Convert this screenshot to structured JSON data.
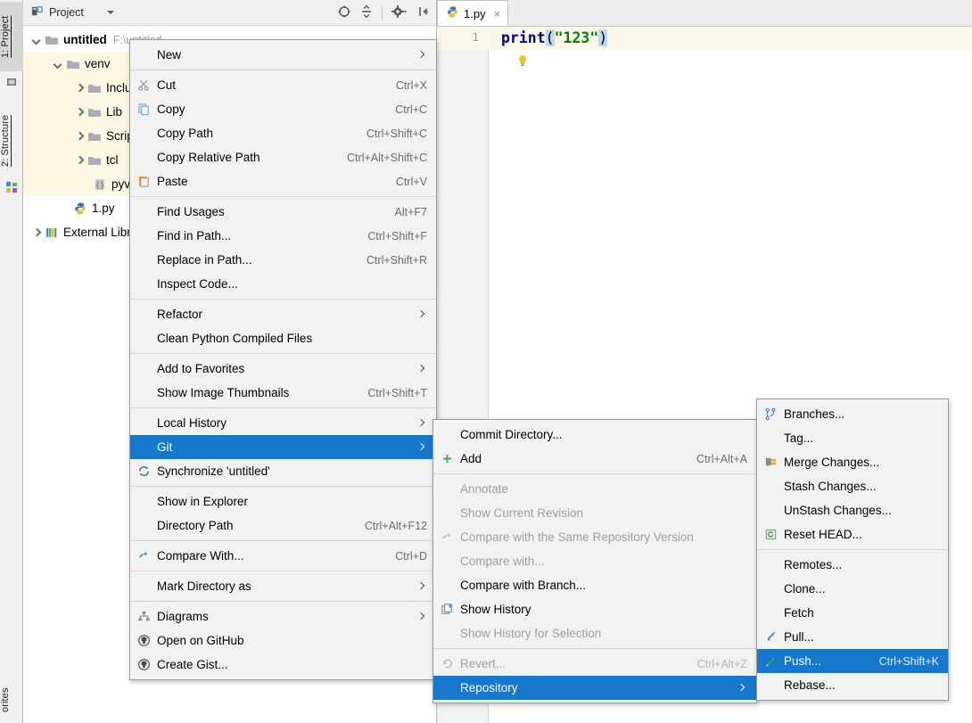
{
  "left_strip": {
    "tabs": [
      {
        "label": "1: Project",
        "icon": "project-icon",
        "active": true
      },
      {
        "label": "2: Structure",
        "icon": "structure-icon",
        "active": false
      },
      {
        "label": "orites",
        "icon": "favorites-icon",
        "active": false
      }
    ]
  },
  "project_panel": {
    "title": "Project",
    "toolbar_icons": [
      "locate-target-icon",
      "collapse-all-icon",
      "gear-dropdown-icon",
      "hide-panel-icon"
    ],
    "tree": [
      {
        "label": "untitled",
        "sub": "F:\\untitled",
        "icon": "folder-module-icon",
        "twisty": "down",
        "indent": 0,
        "bold": true,
        "highlight": false
      },
      {
        "label": "venv",
        "sub": "",
        "icon": "folder-icon",
        "twisty": "down",
        "indent": 1,
        "bold": false,
        "highlight": true
      },
      {
        "label": "Include",
        "sub": "",
        "icon": "folder-icon",
        "twisty": "right",
        "indent": 2,
        "bold": false,
        "highlight": true
      },
      {
        "label": "Lib",
        "sub": "",
        "icon": "folder-icon",
        "twisty": "right",
        "indent": 2,
        "bold": false,
        "highlight": true
      },
      {
        "label": "Scripts",
        "sub": "",
        "icon": "folder-icon",
        "twisty": "right",
        "indent": 2,
        "bold": false,
        "highlight": true
      },
      {
        "label": "tcl",
        "sub": "",
        "icon": "folder-icon",
        "twisty": "right",
        "indent": 2,
        "bold": false,
        "highlight": true
      },
      {
        "label": "pyvenv.cfg",
        "sub": "",
        "icon": "config-file-icon",
        "twisty": "none",
        "indent": 3,
        "bold": false,
        "highlight": true
      },
      {
        "label": "1.py",
        "sub": "",
        "icon": "python-file-icon",
        "twisty": "none",
        "indent": 2,
        "bold": false,
        "highlight": false
      },
      {
        "label": "External Libraries",
        "sub": "",
        "icon": "libraries-icon",
        "twisty": "right",
        "indent": 0,
        "bold": false,
        "highlight": false
      }
    ]
  },
  "editor": {
    "tab": {
      "label": "1.py",
      "icon": "python-file-icon",
      "close": "×"
    },
    "line_number": "1",
    "code": {
      "fn": "print",
      "open_paren": "(",
      "string": "\"123\"",
      "close_paren": ")"
    },
    "bulb_icon": "lightbulb-icon"
  },
  "context_menu": {
    "items": [
      {
        "label": "New",
        "accel": "",
        "icon": "",
        "arrow": true,
        "sep_after": true
      },
      {
        "label": "Cut",
        "accel": "Ctrl+X",
        "icon": "scissors-icon",
        "arrow": false
      },
      {
        "label": "Copy",
        "accel": "Ctrl+C",
        "icon": "copy-icon",
        "arrow": false
      },
      {
        "label": "Copy Path",
        "accel": "Ctrl+Shift+C",
        "icon": "",
        "arrow": false
      },
      {
        "label": "Copy Relative Path",
        "accel": "Ctrl+Alt+Shift+C",
        "icon": "",
        "arrow": false
      },
      {
        "label": "Paste",
        "accel": "Ctrl+V",
        "icon": "paste-icon",
        "arrow": false,
        "sep_after": true
      },
      {
        "label": "Find Usages",
        "accel": "Alt+F7",
        "icon": "",
        "arrow": false
      },
      {
        "label": "Find in Path...",
        "accel": "Ctrl+Shift+F",
        "icon": "",
        "arrow": false
      },
      {
        "label": "Replace in Path...",
        "accel": "Ctrl+Shift+R",
        "icon": "",
        "arrow": false
      },
      {
        "label": "Inspect Code...",
        "accel": "",
        "icon": "",
        "arrow": false,
        "sep_after": true
      },
      {
        "label": "Refactor",
        "accel": "",
        "icon": "",
        "arrow": true
      },
      {
        "label": "Clean Python Compiled Files",
        "accel": "",
        "icon": "",
        "arrow": false,
        "sep_after": true
      },
      {
        "label": "Add to Favorites",
        "accel": "",
        "icon": "",
        "arrow": true
      },
      {
        "label": "Show Image Thumbnails",
        "accel": "Ctrl+Shift+T",
        "icon": "",
        "arrow": false,
        "sep_after": true
      },
      {
        "label": "Local History",
        "accel": "",
        "icon": "",
        "arrow": true
      },
      {
        "label": "Git",
        "accel": "",
        "icon": "",
        "arrow": true,
        "selected": true
      },
      {
        "label": "Synchronize 'untitled'",
        "accel": "",
        "icon": "synchronize-icon",
        "arrow": false,
        "sep_after": true
      },
      {
        "label": "Show in Explorer",
        "accel": "",
        "icon": "",
        "arrow": false
      },
      {
        "label": "Directory Path",
        "accel": "Ctrl+Alt+F12",
        "icon": "",
        "arrow": false,
        "sep_after": true
      },
      {
        "label": "Compare With...",
        "accel": "Ctrl+D",
        "icon": "compare-icon",
        "arrow": false,
        "sep_after": true
      },
      {
        "label": "Mark Directory as",
        "accel": "",
        "icon": "",
        "arrow": true,
        "sep_after": true
      },
      {
        "label": "Diagrams",
        "accel": "",
        "icon": "diagrams-icon",
        "arrow": true
      },
      {
        "label": "Open on GitHub",
        "accel": "",
        "icon": "github-icon",
        "arrow": false
      },
      {
        "label": "Create Gist...",
        "accel": "",
        "icon": "github-icon",
        "arrow": false
      }
    ]
  },
  "git_submenu": {
    "items": [
      {
        "label": "Commit Directory...",
        "accel": "",
        "icon": "",
        "arrow": false,
        "disabled": false
      },
      {
        "label": "Add",
        "accel": "Ctrl+Alt+A",
        "icon": "plus-icon",
        "arrow": false,
        "disabled": false,
        "sep_after": true
      },
      {
        "label": "Annotate",
        "accel": "",
        "icon": "",
        "arrow": false,
        "disabled": true
      },
      {
        "label": "Show Current Revision",
        "accel": "",
        "icon": "",
        "arrow": false,
        "disabled": true
      },
      {
        "label": "Compare with the Same Repository Version",
        "accel": "",
        "icon": "compare-icon-dim",
        "arrow": false,
        "disabled": true
      },
      {
        "label": "Compare with...",
        "accel": "",
        "icon": "",
        "arrow": false,
        "disabled": true
      },
      {
        "label": "Compare with Branch...",
        "accel": "",
        "icon": "",
        "arrow": false,
        "disabled": false
      },
      {
        "label": "Show History",
        "accel": "",
        "icon": "history-icon",
        "arrow": false,
        "disabled": false
      },
      {
        "label": "Show History for Selection",
        "accel": "",
        "icon": "",
        "arrow": false,
        "disabled": true,
        "sep_after": true
      },
      {
        "label": "Revert...",
        "accel": "Ctrl+Alt+Z",
        "icon": "revert-icon",
        "arrow": false,
        "disabled": true
      },
      {
        "label": "Repository",
        "accel": "",
        "icon": "",
        "arrow": true,
        "disabled": false,
        "selected": true
      }
    ]
  },
  "repository_submenu": {
    "items": [
      {
        "label": "Branches...",
        "accel": "",
        "icon": "branches-icon",
        "arrow": false
      },
      {
        "label": "Tag...",
        "accel": "",
        "icon": "",
        "arrow": false
      },
      {
        "label": "Merge Changes...",
        "accel": "",
        "icon": "merge-icon",
        "arrow": false
      },
      {
        "label": "Stash Changes...",
        "accel": "",
        "icon": "",
        "arrow": false
      },
      {
        "label": "UnStash Changes...",
        "accel": "",
        "icon": "",
        "arrow": false
      },
      {
        "label": "Reset HEAD...",
        "accel": "",
        "icon": "reset-icon",
        "arrow": false,
        "sep_after": true
      },
      {
        "label": "Remotes...",
        "accel": "",
        "icon": "",
        "arrow": false
      },
      {
        "label": "Clone...",
        "accel": "",
        "icon": "",
        "arrow": false
      },
      {
        "label": "Fetch",
        "accel": "",
        "icon": "",
        "arrow": false
      },
      {
        "label": "Pull...",
        "accel": "",
        "icon": "pull-icon",
        "arrow": false
      },
      {
        "label": "Push...",
        "accel": "Ctrl+Shift+K",
        "icon": "push-icon",
        "arrow": false,
        "selected": true
      },
      {
        "label": "Rebase...",
        "accel": "",
        "icon": "",
        "arrow": false
      }
    ]
  },
  "colors": {
    "selection_blue": "#1777cc",
    "tree_highlight": "#fcf8e3",
    "menu_bg": "#f2f2f2",
    "accel_gray": "#6b6b6b",
    "disabled_gray": "#9e9e9e"
  }
}
